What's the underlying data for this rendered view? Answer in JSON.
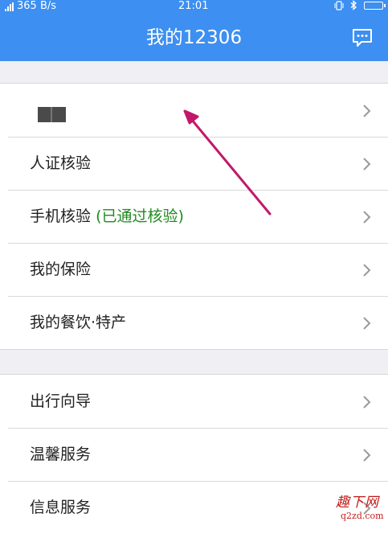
{
  "status_bar": {
    "network_speed": "365 B/s",
    "time": "21:01"
  },
  "header": {
    "title": "我的12306",
    "message_icon": "chat-bubble-icon"
  },
  "section1": {
    "items": [
      {
        "label": "",
        "note": "",
        "icon": "chevron-right-icon"
      },
      {
        "label": "人证核验",
        "note": "",
        "icon": "chevron-right-icon"
      },
      {
        "label": "手机核验",
        "note": "(已通过核验)",
        "icon": "chevron-right-icon"
      },
      {
        "label": "我的保险",
        "note": "",
        "icon": "chevron-right-icon"
      },
      {
        "label": "我的餐饮·特产",
        "note": "",
        "icon": "chevron-right-icon"
      }
    ]
  },
  "section2": {
    "items": [
      {
        "label": "出行向导",
        "icon": "chevron-right-icon"
      },
      {
        "label": "温馨服务",
        "icon": "chevron-right-icon"
      },
      {
        "label": "信息服务",
        "icon": "chevron-right-icon"
      }
    ]
  },
  "watermark": {
    "top": "趣下网",
    "bottom": "q2zd.com"
  },
  "colors": {
    "header_bg": "#3d8ff1",
    "verified_text": "#1f8a1f",
    "annotation_arrow": "#c2186b",
    "watermark": "#c21a1a"
  }
}
